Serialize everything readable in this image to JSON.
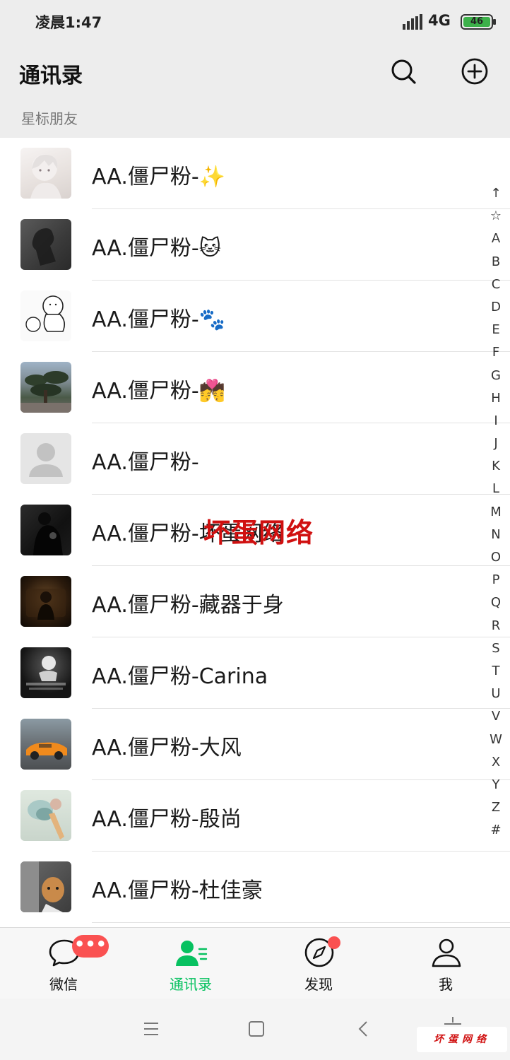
{
  "status": {
    "time": "凌晨1:47",
    "network": "4G",
    "battery": "46"
  },
  "header": {
    "title": "通讯录"
  },
  "section": {
    "starred_title": "星标朋友"
  },
  "contacts": [
    {
      "name": "AA.僵尸粉-✨"
    },
    {
      "name": "AA.僵尸粉-🐱"
    },
    {
      "name": "AA.僵尸粉-🐾"
    },
    {
      "name": "AA.僵尸粉-💏"
    },
    {
      "name": "AA.僵尸粉-"
    },
    {
      "name": "AA.僵尸粉-坏蛋网络"
    },
    {
      "name": "AA.僵尸粉-藏器于身"
    },
    {
      "name": "AA.僵尸粉-Carina"
    },
    {
      "name": "AA.僵尸粉-大风"
    },
    {
      "name": "AA.僵尸粉-殷尚"
    },
    {
      "name": "AA.僵尸粉-杜佳豪"
    }
  ],
  "index_letters": [
    "↑",
    "☆",
    "A",
    "B",
    "C",
    "D",
    "E",
    "F",
    "G",
    "H",
    "I",
    "J",
    "K",
    "L",
    "M",
    "N",
    "O",
    "P",
    "Q",
    "R",
    "S",
    "T",
    "U",
    "V",
    "W",
    "X",
    "Y",
    "Z",
    "#"
  ],
  "watermark": {
    "text": "坏蛋网络"
  },
  "tabs": [
    {
      "label": "微信",
      "icon": "chat-bubble-icon",
      "badge": "•••"
    },
    {
      "label": "通讯录",
      "icon": "contacts-icon"
    },
    {
      "label": "发现",
      "icon": "compass-icon"
    },
    {
      "label": "我",
      "icon": "person-icon"
    }
  ],
  "navbar": {
    "brand_text": "坏蛋网络"
  },
  "colors": {
    "accent": "#07c160",
    "badge": "#fa5151",
    "background": "#ededed"
  }
}
